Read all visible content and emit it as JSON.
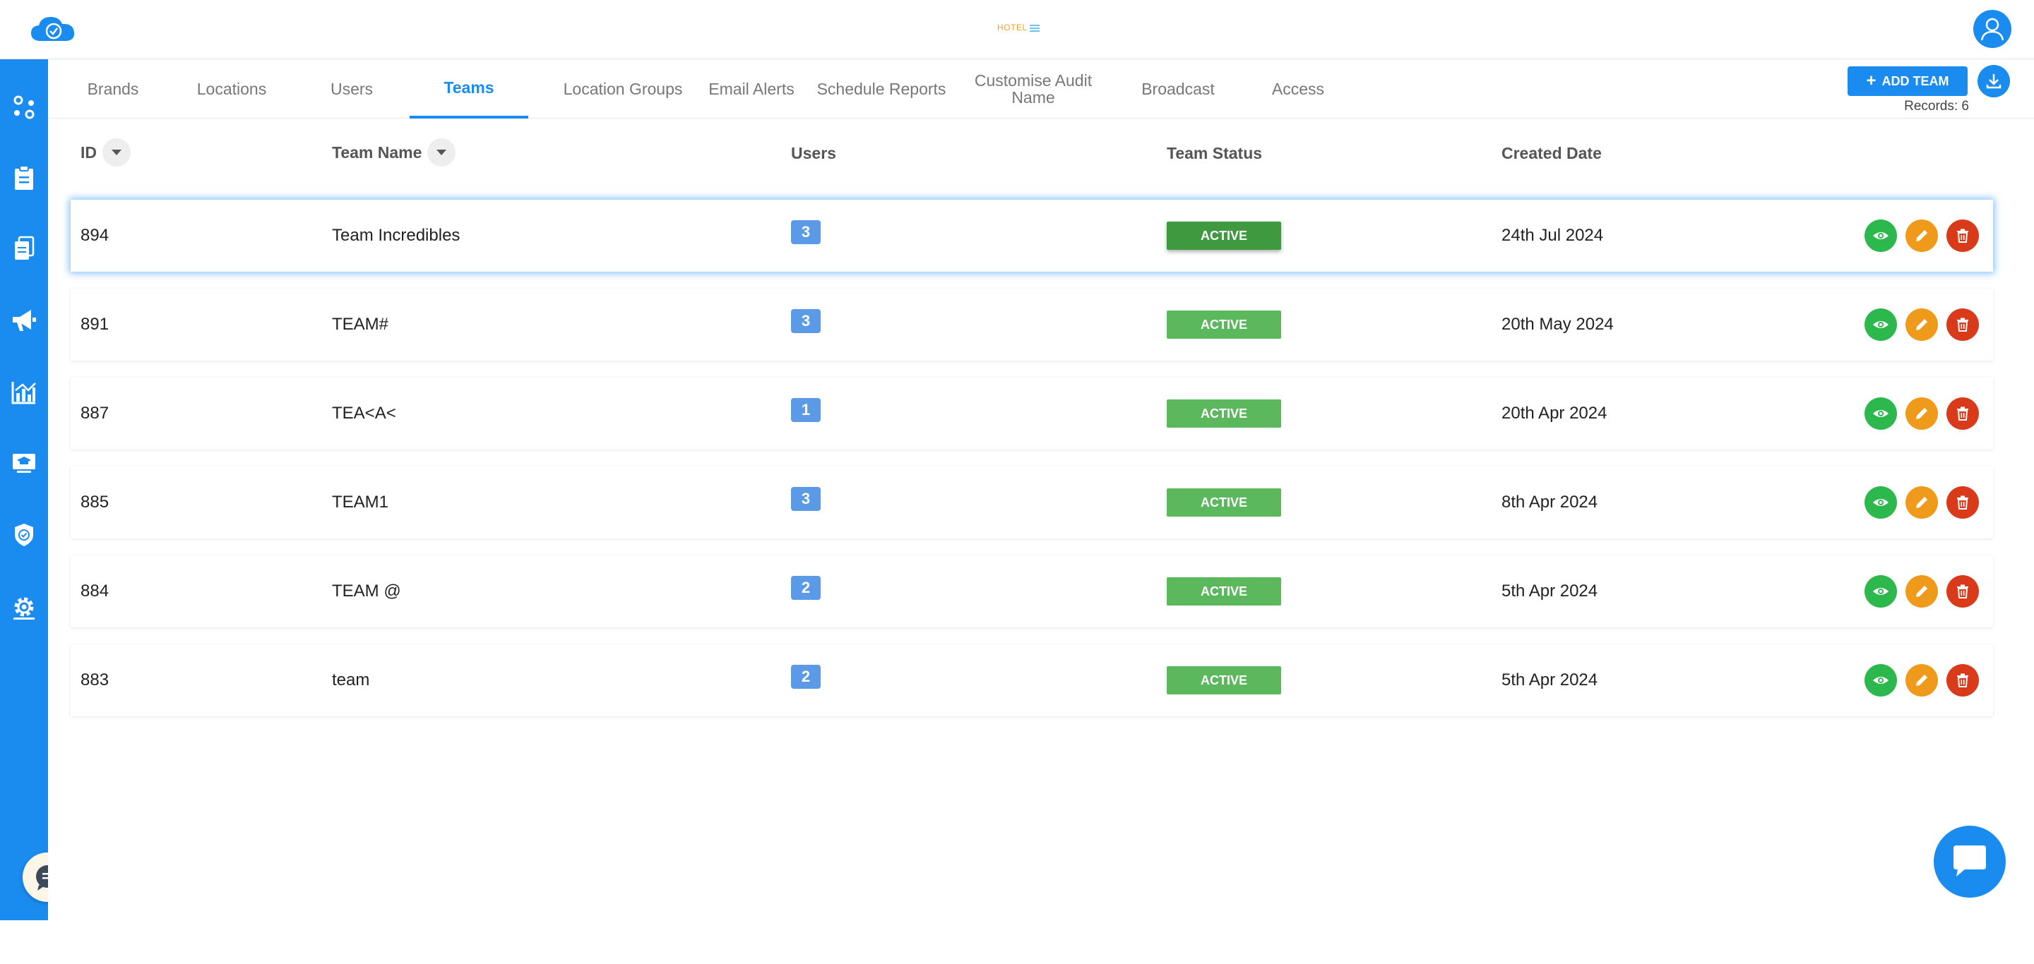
{
  "app": {
    "brand_text": "HOTEL",
    "colors": {
      "primary": "#1a8cf0",
      "active_status": "#5cb85c",
      "view": "#2db84d",
      "edit": "#f09a1c",
      "delete": "#d93a1a",
      "badge": "#5a9ae6"
    }
  },
  "sidebar": {
    "items": [
      {
        "icon": "dashboard-icon"
      },
      {
        "icon": "clipboard-icon"
      },
      {
        "icon": "documents-icon"
      },
      {
        "icon": "megaphone-icon"
      },
      {
        "icon": "analytics-icon"
      },
      {
        "icon": "training-icon"
      },
      {
        "icon": "shield-icon"
      },
      {
        "icon": "gear-icon"
      }
    ]
  },
  "tabs": [
    {
      "label": "Brands"
    },
    {
      "label": "Locations"
    },
    {
      "label": "Users"
    },
    {
      "label": "Teams",
      "active": true
    },
    {
      "label": "Location Groups"
    },
    {
      "label": "Email Alerts"
    },
    {
      "label": "Schedule Reports"
    },
    {
      "label": "Customise Audit Name"
    },
    {
      "label": "Broadcast"
    },
    {
      "label": "Access"
    }
  ],
  "toolbar": {
    "add_team_label": "ADD TEAM",
    "records_label": "Records: 6"
  },
  "table": {
    "columns": [
      "ID",
      "Team Name",
      "Users",
      "Team Status",
      "Created Date"
    ],
    "rows": [
      {
        "id": "894",
        "name": "Team Incredibles",
        "users": "3",
        "status": "ACTIVE",
        "created": "24th Jul 2024"
      },
      {
        "id": "891",
        "name": "TEAM#",
        "users": "3",
        "status": "ACTIVE",
        "created": "20th May 2024"
      },
      {
        "id": "887",
        "name": "TEA<A<",
        "users": "1",
        "status": "ACTIVE",
        "created": "20th Apr 2024"
      },
      {
        "id": "885",
        "name": "TEAM1",
        "users": "3",
        "status": "ACTIVE",
        "created": "8th Apr 2024"
      },
      {
        "id": "884",
        "name": "TEAM @",
        "users": "2",
        "status": "ACTIVE",
        "created": "5th Apr 2024"
      },
      {
        "id": "883",
        "name": "team",
        "users": "2",
        "status": "ACTIVE",
        "created": "5th Apr 2024"
      }
    ]
  }
}
